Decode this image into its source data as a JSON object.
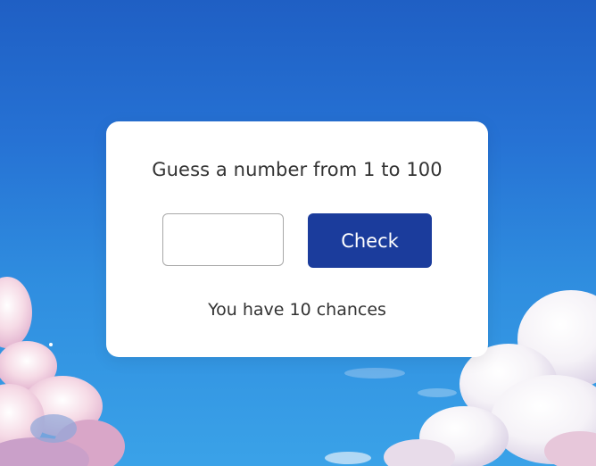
{
  "card": {
    "title": "Guess a number from 1 to 100",
    "input": {
      "value": "",
      "placeholder": ""
    },
    "check_label": "Check",
    "chances_text": "You have 10 chances"
  },
  "colors": {
    "button_bg": "#1b3c9c",
    "card_bg": "#ffffff",
    "text": "#333333",
    "sky_top": "#1f5fc4",
    "sky_bottom": "#3aa2e8"
  }
}
